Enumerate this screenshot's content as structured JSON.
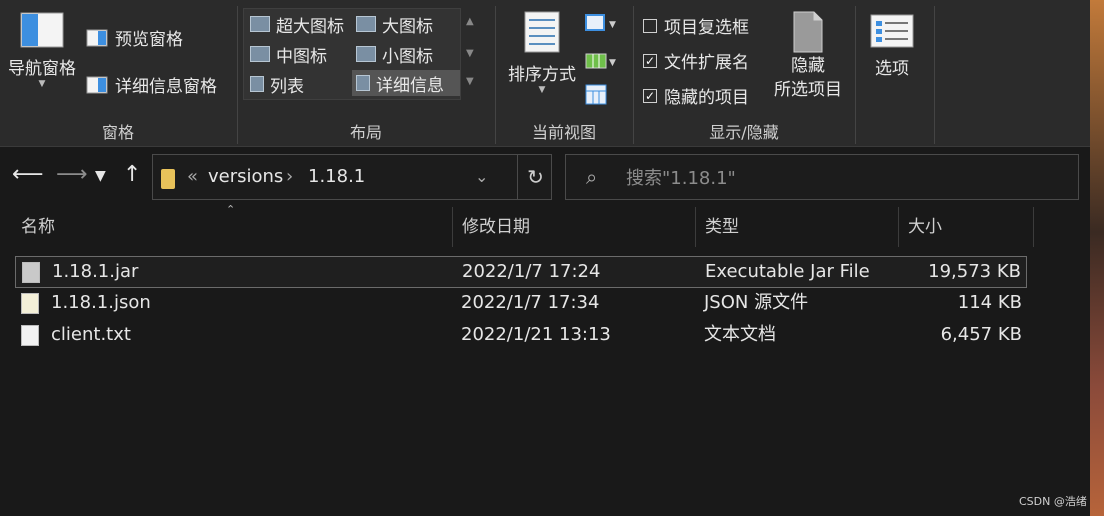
{
  "ribbon": {
    "pane": {
      "nav_pane": "导航窗格",
      "preview_pane": "预览窗格",
      "details_pane": "详细信息窗格",
      "group_label": "窗格"
    },
    "layout": {
      "items": [
        "超大图标",
        "大图标",
        "中图标",
        "小图标",
        "列表",
        "详细信息"
      ],
      "selected": "详细信息",
      "group_label": "布局"
    },
    "current_view": {
      "sort_by": "排序方式",
      "group_label": "当前视图"
    },
    "show_hide": {
      "item_checkboxes": {
        "label": "项目复选框",
        "checked": false
      },
      "file_extensions": {
        "label": "文件扩展名",
        "checked": true
      },
      "hidden_items": {
        "label": "隐藏的项目",
        "checked": true
      },
      "hide_selected_1": "隐藏",
      "hide_selected_2": "所选项目",
      "group_label": "显示/隐藏"
    },
    "options": "选项"
  },
  "nav": {
    "breadcrumb_overflow": "«",
    "breadcrumb": [
      "versions",
      "1.18.1"
    ],
    "search_placeholder": "搜索\"1.18.1\""
  },
  "columns": [
    "名称",
    "修改日期",
    "类型",
    "大小"
  ],
  "files": [
    {
      "name": "1.18.1.jar",
      "modified": "2022/1/7 17:24",
      "type": "Executable Jar File",
      "size": "19,573 KB",
      "selected": true,
      "icon": "jar-file-icon"
    },
    {
      "name": "1.18.1.json",
      "modified": "2022/1/7 17:34",
      "type": "JSON 源文件",
      "size": "114 KB",
      "selected": false,
      "icon": "json-file-icon"
    },
    {
      "name": "client.txt",
      "modified": "2022/1/21 13:13",
      "type": "文本文档",
      "size": "6,457 KB",
      "selected": false,
      "icon": "text-file-icon"
    }
  ],
  "watermark": "CSDN @浩绪"
}
